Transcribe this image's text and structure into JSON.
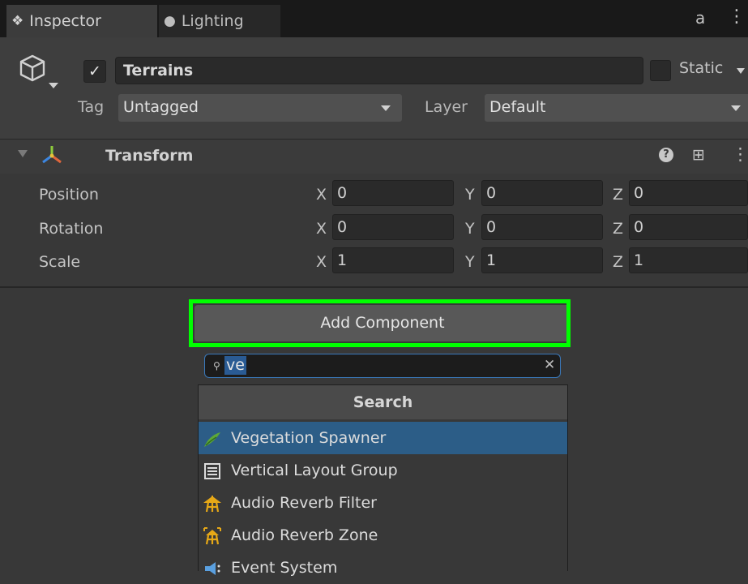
{
  "tabs": [
    {
      "label": "Inspector",
      "icon": "info-icon"
    },
    {
      "label": "Lighting",
      "icon": "lightbulb-icon"
    }
  ],
  "header": {
    "active": true,
    "name": "Terrains",
    "static_label": "Static",
    "static_checked": false,
    "tag_label": "Tag",
    "tag_value": "Untagged",
    "layer_label": "Layer",
    "layer_value": "Default"
  },
  "transform": {
    "title": "Transform",
    "rows": [
      {
        "label": "Position",
        "x": "0",
        "y": "0",
        "z": "0"
      },
      {
        "label": "Rotation",
        "x": "0",
        "y": "0",
        "z": "0"
      },
      {
        "label": "Scale",
        "x": "1",
        "y": "1",
        "z": "1"
      }
    ],
    "axes": {
      "x": "X",
      "y": "Y",
      "z": "Z"
    }
  },
  "add_component": {
    "button_label": "Add Component",
    "search_value": "ve",
    "list_header": "Search",
    "items": [
      {
        "label": "Vegetation Spawner",
        "icon": "vegetation-spawner-icon",
        "selected": true
      },
      {
        "label": "Vertical Layout Group",
        "icon": "layout-group-icon",
        "selected": false
      },
      {
        "label": "Audio Reverb Filter",
        "icon": "audio-reverb-filter-icon",
        "selected": false
      },
      {
        "label": "Audio Reverb Zone",
        "icon": "audio-reverb-zone-icon",
        "selected": false
      },
      {
        "label": "Event System",
        "icon": "event-system-icon",
        "selected": false
      }
    ]
  },
  "colors": {
    "highlight": "#00ff00",
    "selection": "#2c5d87",
    "panel": "#383838"
  }
}
